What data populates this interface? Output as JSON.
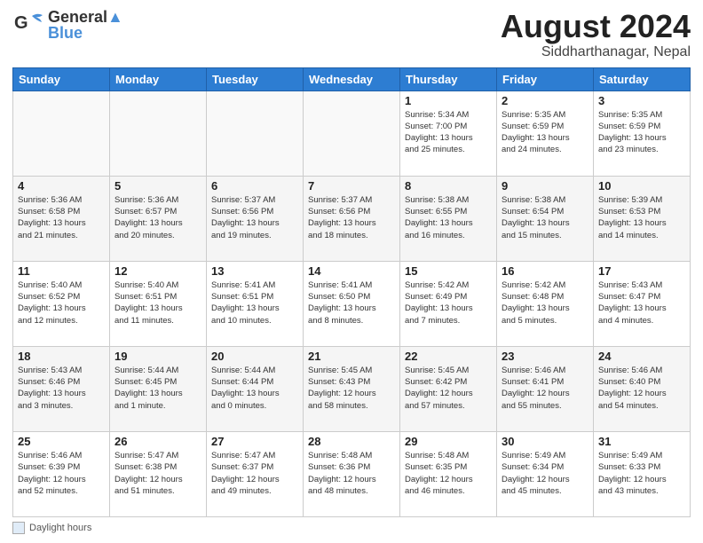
{
  "header": {
    "logo_line1": "General",
    "logo_line2": "Blue",
    "title": "August 2024",
    "subtitle": "Siddharthanagar, Nepal"
  },
  "calendar": {
    "days_of_week": [
      "Sunday",
      "Monday",
      "Tuesday",
      "Wednesday",
      "Thursday",
      "Friday",
      "Saturday"
    ],
    "weeks": [
      [
        {
          "date": "",
          "info": ""
        },
        {
          "date": "",
          "info": ""
        },
        {
          "date": "",
          "info": ""
        },
        {
          "date": "",
          "info": ""
        },
        {
          "date": "1",
          "info": "Sunrise: 5:34 AM\nSunset: 7:00 PM\nDaylight: 13 hours\nand 25 minutes."
        },
        {
          "date": "2",
          "info": "Sunrise: 5:35 AM\nSunset: 6:59 PM\nDaylight: 13 hours\nand 24 minutes."
        },
        {
          "date": "3",
          "info": "Sunrise: 5:35 AM\nSunset: 6:59 PM\nDaylight: 13 hours\nand 23 minutes."
        }
      ],
      [
        {
          "date": "4",
          "info": "Sunrise: 5:36 AM\nSunset: 6:58 PM\nDaylight: 13 hours\nand 21 minutes."
        },
        {
          "date": "5",
          "info": "Sunrise: 5:36 AM\nSunset: 6:57 PM\nDaylight: 13 hours\nand 20 minutes."
        },
        {
          "date": "6",
          "info": "Sunrise: 5:37 AM\nSunset: 6:56 PM\nDaylight: 13 hours\nand 19 minutes."
        },
        {
          "date": "7",
          "info": "Sunrise: 5:37 AM\nSunset: 6:56 PM\nDaylight: 13 hours\nand 18 minutes."
        },
        {
          "date": "8",
          "info": "Sunrise: 5:38 AM\nSunset: 6:55 PM\nDaylight: 13 hours\nand 16 minutes."
        },
        {
          "date": "9",
          "info": "Sunrise: 5:38 AM\nSunset: 6:54 PM\nDaylight: 13 hours\nand 15 minutes."
        },
        {
          "date": "10",
          "info": "Sunrise: 5:39 AM\nSunset: 6:53 PM\nDaylight: 13 hours\nand 14 minutes."
        }
      ],
      [
        {
          "date": "11",
          "info": "Sunrise: 5:40 AM\nSunset: 6:52 PM\nDaylight: 13 hours\nand 12 minutes."
        },
        {
          "date": "12",
          "info": "Sunrise: 5:40 AM\nSunset: 6:51 PM\nDaylight: 13 hours\nand 11 minutes."
        },
        {
          "date": "13",
          "info": "Sunrise: 5:41 AM\nSunset: 6:51 PM\nDaylight: 13 hours\nand 10 minutes."
        },
        {
          "date": "14",
          "info": "Sunrise: 5:41 AM\nSunset: 6:50 PM\nDaylight: 13 hours\nand 8 minutes."
        },
        {
          "date": "15",
          "info": "Sunrise: 5:42 AM\nSunset: 6:49 PM\nDaylight: 13 hours\nand 7 minutes."
        },
        {
          "date": "16",
          "info": "Sunrise: 5:42 AM\nSunset: 6:48 PM\nDaylight: 13 hours\nand 5 minutes."
        },
        {
          "date": "17",
          "info": "Sunrise: 5:43 AM\nSunset: 6:47 PM\nDaylight: 13 hours\nand 4 minutes."
        }
      ],
      [
        {
          "date": "18",
          "info": "Sunrise: 5:43 AM\nSunset: 6:46 PM\nDaylight: 13 hours\nand 3 minutes."
        },
        {
          "date": "19",
          "info": "Sunrise: 5:44 AM\nSunset: 6:45 PM\nDaylight: 13 hours\nand 1 minute."
        },
        {
          "date": "20",
          "info": "Sunrise: 5:44 AM\nSunset: 6:44 PM\nDaylight: 13 hours\nand 0 minutes."
        },
        {
          "date": "21",
          "info": "Sunrise: 5:45 AM\nSunset: 6:43 PM\nDaylight: 12 hours\nand 58 minutes."
        },
        {
          "date": "22",
          "info": "Sunrise: 5:45 AM\nSunset: 6:42 PM\nDaylight: 12 hours\nand 57 minutes."
        },
        {
          "date": "23",
          "info": "Sunrise: 5:46 AM\nSunset: 6:41 PM\nDaylight: 12 hours\nand 55 minutes."
        },
        {
          "date": "24",
          "info": "Sunrise: 5:46 AM\nSunset: 6:40 PM\nDaylight: 12 hours\nand 54 minutes."
        }
      ],
      [
        {
          "date": "25",
          "info": "Sunrise: 5:46 AM\nSunset: 6:39 PM\nDaylight: 12 hours\nand 52 minutes."
        },
        {
          "date": "26",
          "info": "Sunrise: 5:47 AM\nSunset: 6:38 PM\nDaylight: 12 hours\nand 51 minutes."
        },
        {
          "date": "27",
          "info": "Sunrise: 5:47 AM\nSunset: 6:37 PM\nDaylight: 12 hours\nand 49 minutes."
        },
        {
          "date": "28",
          "info": "Sunrise: 5:48 AM\nSunset: 6:36 PM\nDaylight: 12 hours\nand 48 minutes."
        },
        {
          "date": "29",
          "info": "Sunrise: 5:48 AM\nSunset: 6:35 PM\nDaylight: 12 hours\nand 46 minutes."
        },
        {
          "date": "30",
          "info": "Sunrise: 5:49 AM\nSunset: 6:34 PM\nDaylight: 12 hours\nand 45 minutes."
        },
        {
          "date": "31",
          "info": "Sunrise: 5:49 AM\nSunset: 6:33 PM\nDaylight: 12 hours\nand 43 minutes."
        }
      ]
    ]
  },
  "footer": {
    "legend_label": "Daylight hours"
  }
}
